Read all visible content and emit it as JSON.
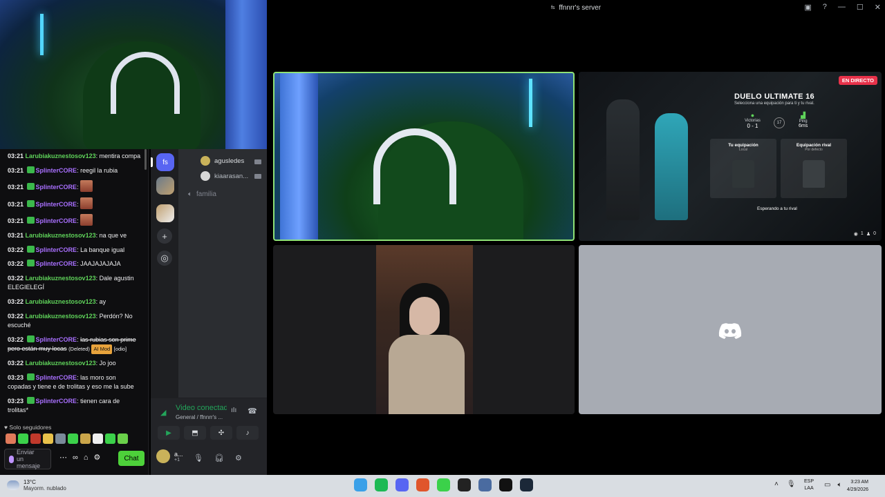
{
  "window": {
    "title": "ffnnrr's server",
    "server_short": "fs"
  },
  "chat": {
    "messages": [
      {
        "time": "03:21",
        "user": "Larubiakuznestosov123",
        "user_color": "#5fd35a",
        "badge": false,
        "text": "mentira compa"
      },
      {
        "time": "03:21",
        "user": "SplinterCORE",
        "user_color": "#a970ff",
        "badge": true,
        "text": "reegil la rubia"
      },
      {
        "time": "03:21",
        "user": "SplinterCORE",
        "user_color": "#a970ff",
        "badge": true,
        "text": "",
        "emote": true
      },
      {
        "time": "03:21",
        "user": "SplinterCORE",
        "user_color": "#a970ff",
        "badge": true,
        "text": "",
        "emote": true
      },
      {
        "time": "03:21",
        "user": "SplinterCORE",
        "user_color": "#a970ff",
        "badge": true,
        "text": "",
        "emote": true
      },
      {
        "time": "03:21",
        "user": "Larubiakuznestosov123",
        "user_color": "#5fd35a",
        "badge": false,
        "text": "na que ve"
      },
      {
        "time": "03:22",
        "user": "SplinterCORE",
        "user_color": "#a970ff",
        "badge": true,
        "text": "La banque igual"
      },
      {
        "time": "03:22",
        "user": "SplinterCORE",
        "user_color": "#a970ff",
        "badge": true,
        "text": "JAAJAJAJAJA"
      },
      {
        "time": "03:22",
        "user": "Larubiakuznestosov123",
        "user_color": "#5fd35a",
        "badge": false,
        "text": "Dale agustin ELEGIELEGÍ"
      },
      {
        "time": "03:22",
        "user": "Larubiakuznestosov123",
        "user_color": "#5fd35a",
        "badge": false,
        "text": "ay"
      },
      {
        "time": "03:22",
        "user": "Larubiakuznestosov123",
        "user_color": "#5fd35a",
        "badge": false,
        "text": "Perdón? No escuché"
      },
      {
        "time": "03:22",
        "user": "SplinterCORE",
        "user_color": "#a970ff",
        "badge": true,
        "text": "las rubias son prime pero están muy locas",
        "deleted": true,
        "deleted_label": "(Deleted)",
        "mod_label": "AI Mod",
        "reason": "[odio]"
      },
      {
        "time": "03:22",
        "user": "Larubiakuznestosov123",
        "user_color": "#5fd35a",
        "badge": false,
        "text": "Jo joo"
      },
      {
        "time": "03:23",
        "user": "SplinterCORE",
        "user_color": "#a970ff",
        "badge": true,
        "text": "las moro son copadas y tiene e de trolitas y eso me la sube"
      },
      {
        "time": "03:23",
        "user": "SplinterCORE",
        "user_color": "#a970ff",
        "badge": true,
        "text": "tienen cara de trolitas*"
      }
    ],
    "followers_only": "Solo seguidores",
    "placeholder": "Enviar un mensaje",
    "chat_button": "Chat",
    "emote_colors": [
      "#e07a5a",
      "#3bd14a",
      "#c0392b",
      "#e8c14a",
      "#7a8a9a",
      "#3bd14a",
      "#caa54a",
      "#eeeeee",
      "#3bd14a",
      "#6ad04a"
    ]
  },
  "discord": {
    "voice_users": [
      {
        "name": "agusledes",
        "color": "#c9b25a"
      },
      {
        "name": "kiaarasan...",
        "color": "#d8d8d8"
      }
    ],
    "channel": "familia",
    "voice_status": "Video conectado",
    "voice_sub": "General / ffnnrr's ...",
    "user_name": "a...",
    "user_sub": "+1"
  },
  "game": {
    "live_label": "EN DIRECTO",
    "title": "DUELO ULTIMATE 16",
    "subtitle": "Selecciona una equipación para ti y tu rival.",
    "wins_label": "Victorias",
    "wins_value": "0 - 1",
    "round": "17",
    "ping_label": "Ping",
    "ping_value": "6ms",
    "your_kit": "Tu equipación",
    "your_kit_sub": "Local",
    "rival_kit": "Equipación rival",
    "rival_kit_sub": "Por defecto",
    "waiting": "Esperando a tu rival",
    "viewers": "1",
    "participants": "0"
  },
  "taskbar": {
    "temp": "13°C",
    "weather": "Mayorm. nublado",
    "lang1": "ESP",
    "lang2": "LAA",
    "time": "3:23 AM",
    "date": "4/29/2026",
    "app_colors": [
      "#3aa0e8",
      "#1db954",
      "#5865f2",
      "#e0552b",
      "#3bd14a",
      "#222222",
      "#4a6ba0",
      "#111111",
      "#1b2838"
    ]
  }
}
